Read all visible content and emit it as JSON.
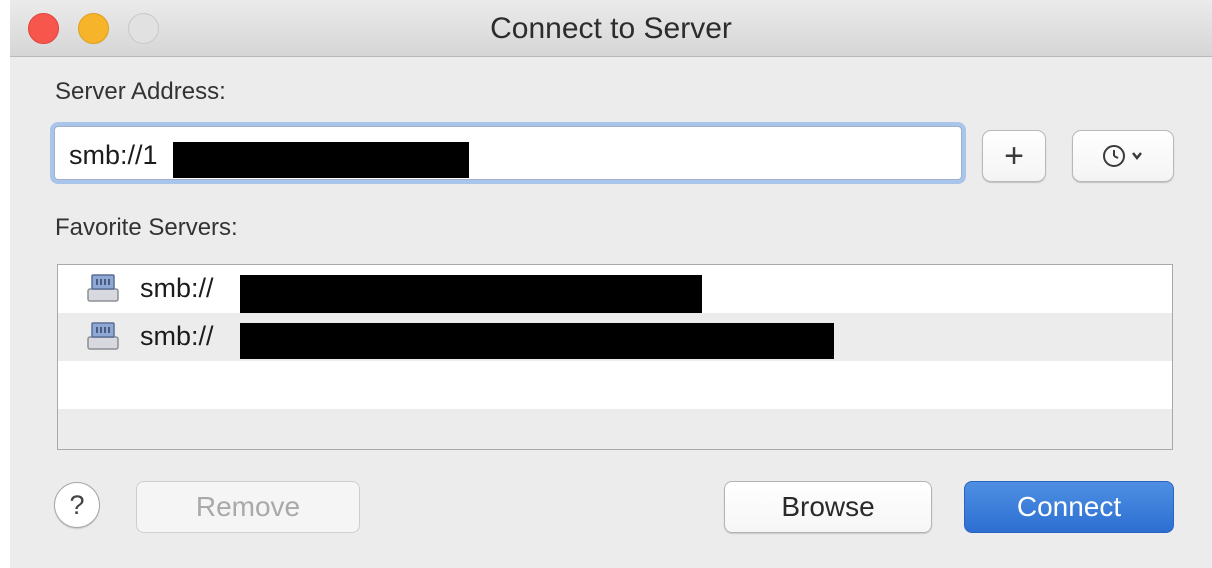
{
  "window": {
    "title": "Connect to Server"
  },
  "server_address": {
    "label": "Server Address:",
    "value": "smb://1",
    "add_button_symbol": "+",
    "history_button_icon": "clock-icon"
  },
  "favorites": {
    "label": "Favorite Servers:",
    "items": [
      {
        "label": "smb://",
        "icon": "network-drive-icon"
      },
      {
        "label": "smb://",
        "icon": "network-drive-icon"
      }
    ]
  },
  "footer": {
    "help_symbol": "?",
    "remove_label": "Remove",
    "browse_label": "Browse",
    "connect_label": "Connect"
  },
  "colors": {
    "accent": "#2d6fd1",
    "focus_ring": "#a9c5ea",
    "close": "#f7564c",
    "minimize": "#f5b42a",
    "zoom_disabled": "#e1e1e1",
    "list_stripe": "#ececec"
  }
}
